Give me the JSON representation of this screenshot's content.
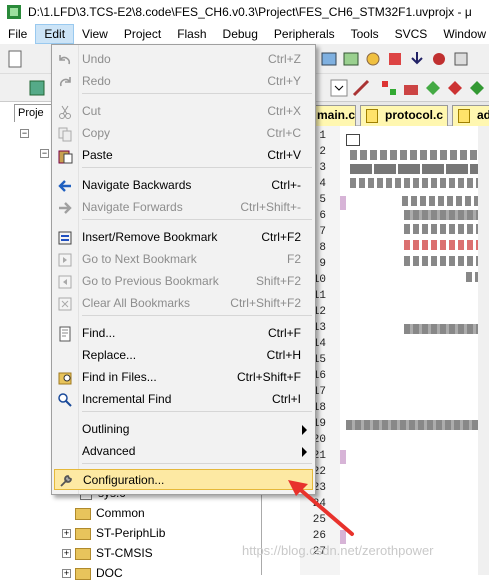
{
  "window": {
    "title": "D:\\1.LFD\\3.TCS-E2\\8.code\\FES_CH6.v0.3\\Project\\FES_CH6_STM32F1.uvprojx - μ"
  },
  "menubar": [
    {
      "label": "File"
    },
    {
      "label": "Edit"
    },
    {
      "label": "View"
    },
    {
      "label": "Project"
    },
    {
      "label": "Flash"
    },
    {
      "label": "Debug"
    },
    {
      "label": "Peripherals"
    },
    {
      "label": "Tools"
    },
    {
      "label": "SVCS"
    },
    {
      "label": "Window"
    }
  ],
  "edit_menu": {
    "items": [
      {
        "label": "Undo",
        "shortcut": "Ctrl+Z",
        "enabled": false,
        "icon": "undo-icon"
      },
      {
        "label": "Redo",
        "shortcut": "Ctrl+Y",
        "enabled": false,
        "icon": "redo-icon"
      },
      {
        "label": "Cut",
        "shortcut": "Ctrl+X",
        "enabled": false,
        "icon": "cut-icon"
      },
      {
        "label": "Copy",
        "shortcut": "Ctrl+C",
        "enabled": false,
        "icon": "copy-icon"
      },
      {
        "label": "Paste",
        "shortcut": "Ctrl+V",
        "enabled": true,
        "icon": "paste-icon"
      },
      {
        "label": "Navigate Backwards",
        "shortcut": "Ctrl+-",
        "enabled": true,
        "icon": "arrow-left-icon"
      },
      {
        "label": "Navigate Forwards",
        "shortcut": "Ctrl+Shift+-",
        "enabled": false,
        "icon": "arrow-right-icon"
      },
      {
        "label": "Insert/Remove Bookmark",
        "shortcut": "Ctrl+F2",
        "enabled": true,
        "icon": "bookmark-icon"
      },
      {
        "label": "Go to Next Bookmark",
        "shortcut": "F2",
        "enabled": false,
        "icon": "next-bookmark-icon"
      },
      {
        "label": "Go to Previous Bookmark",
        "shortcut": "Shift+F2",
        "enabled": false,
        "icon": "previous-bookmark-icon"
      },
      {
        "label": "Clear All Bookmarks",
        "shortcut": "Ctrl+Shift+F2",
        "enabled": false,
        "icon": "clear-bookmarks-icon"
      },
      {
        "label": "Find...",
        "shortcut": "Ctrl+F",
        "enabled": true,
        "icon": "find-icon"
      },
      {
        "label": "Replace...",
        "shortcut": "Ctrl+H",
        "enabled": true,
        "icon": ""
      },
      {
        "label": "Find in Files...",
        "shortcut": "Ctrl+Shift+F",
        "enabled": true,
        "icon": "find-in-files-icon"
      },
      {
        "label": "Incremental Find",
        "shortcut": "Ctrl+I",
        "enabled": true,
        "icon": "incremental-find-icon"
      },
      {
        "label": "Outlining",
        "shortcut": "",
        "enabled": true,
        "icon": "",
        "submenu": true
      },
      {
        "label": "Advanced",
        "shortcut": "",
        "enabled": true,
        "icon": "",
        "submenu": true
      },
      {
        "label": "Configuration...",
        "shortcut": "",
        "enabled": true,
        "icon": "wrench-icon",
        "highlighted": true
      }
    ]
  },
  "project_panel": {
    "tab_label": "Proje",
    "tree": [
      {
        "label": "sys.c"
      },
      {
        "label": "Common"
      },
      {
        "label": "ST-PeriphLib"
      },
      {
        "label": "ST-CMSIS"
      },
      {
        "label": "DOC"
      }
    ]
  },
  "editor": {
    "tabs": [
      {
        "label": "main.c"
      },
      {
        "label": "protocol.c"
      },
      {
        "label": "ad"
      }
    ],
    "line_numbers": [
      "1",
      "2",
      "3",
      "4",
      "5",
      "6",
      "7",
      "8",
      "9",
      "10",
      "11",
      "12",
      "13",
      "14",
      "15",
      "16",
      "17",
      "18",
      "19",
      "20",
      "21",
      "22",
      "23",
      "24",
      "25",
      "26",
      "27"
    ]
  },
  "watermark": "https://blog.csdn.net/zerothpower",
  "colors": {
    "menu_highlight": "#fde9a3",
    "menu_background": "#f2f2f2",
    "tab_yellow": "#fff7b0",
    "annotation_arrow": "#e8322c"
  }
}
